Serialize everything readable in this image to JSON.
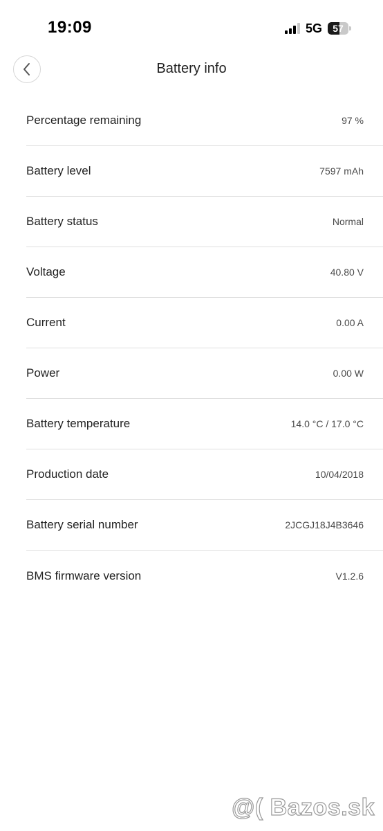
{
  "status_bar": {
    "time": "19:09",
    "network": "5G",
    "battery_percent": "57",
    "battery_fill_fraction": 0.57,
    "signal_bars_active": 3,
    "signal_bars_total": 4
  },
  "header": {
    "title": "Battery info",
    "back_icon": "chevron-left-icon"
  },
  "items": [
    {
      "label": "Percentage remaining",
      "value": "97 %"
    },
    {
      "label": "Battery level",
      "value": "7597 mAh"
    },
    {
      "label": "Battery status",
      "value": "Normal"
    },
    {
      "label": "Voltage",
      "value": "40.80 V"
    },
    {
      "label": "Current",
      "value": "0.00 A"
    },
    {
      "label": "Power",
      "value": "0.00 W"
    },
    {
      "label": "Battery temperature",
      "value": "14.0 °C / 17.0 °C"
    },
    {
      "label": "Production date",
      "value": "10/04/2018"
    },
    {
      "label": "Battery serial number",
      "value": "2JCGJ18J4B3646"
    },
    {
      "label": "BMS firmware version",
      "value": "V1.2.6"
    }
  ],
  "watermark": {
    "text": "@( Bazos.sk"
  },
  "colors": {
    "divider": "#dedede",
    "label": "#222222",
    "value": "#4a4a4a"
  }
}
